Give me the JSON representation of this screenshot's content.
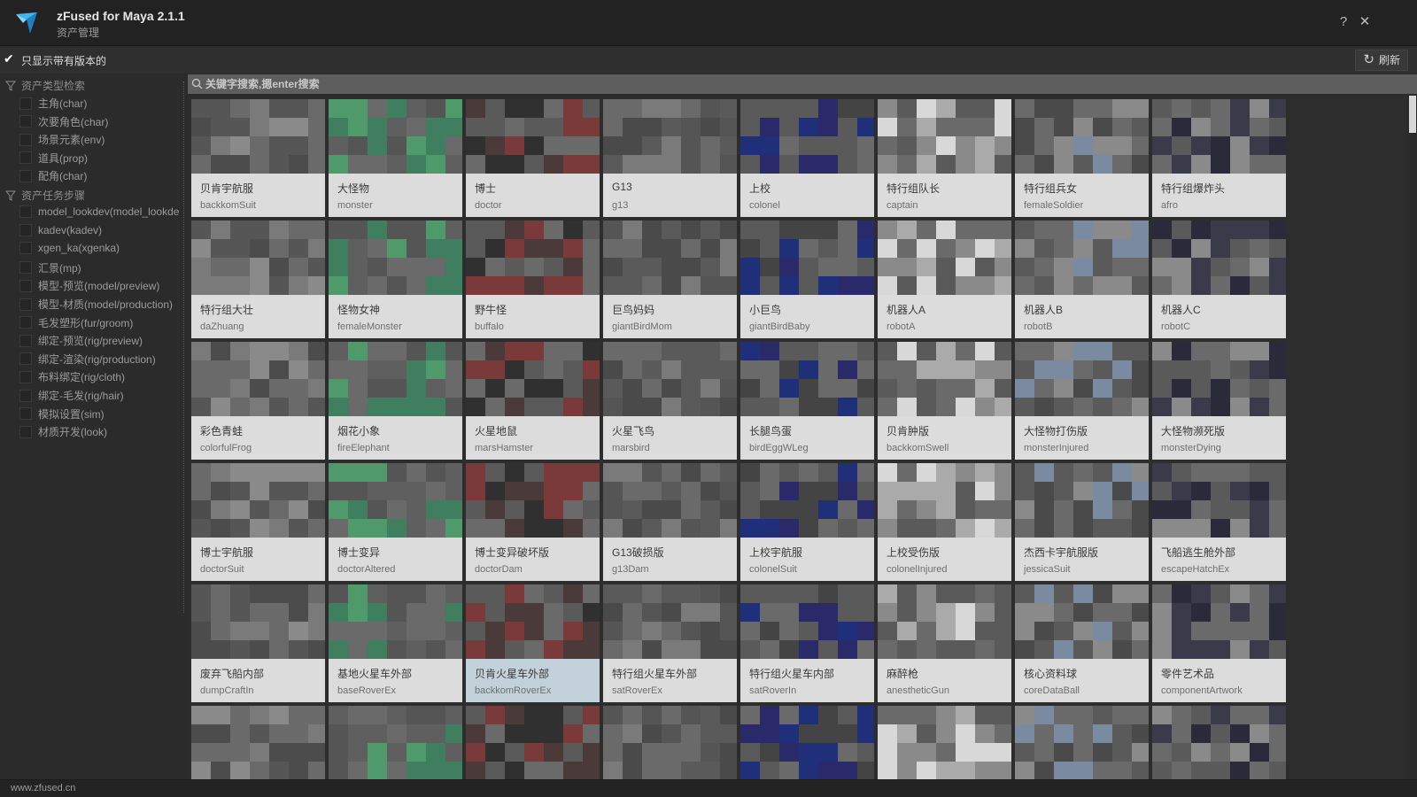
{
  "window": {
    "title": "zFused for Maya 2.1.1",
    "subtitle": "资产管理",
    "help_icon": "help-icon",
    "close_icon": "close-icon"
  },
  "options": {
    "show_versioned_label": "只显示带有版本的",
    "show_versioned_checked": true,
    "refresh_label": "刷新"
  },
  "search": {
    "placeholder": "关键字搜索,摁enter搜索",
    "value": ""
  },
  "sidebar": {
    "type_header": "资产类型检索",
    "types": [
      {
        "label": "主角(char)",
        "checked": false
      },
      {
        "label": "次要角色(char)",
        "checked": false
      },
      {
        "label": "场景元素(env)",
        "checked": false
      },
      {
        "label": "道具(prop)",
        "checked": false
      },
      {
        "label": "配角(char)",
        "checked": false
      }
    ],
    "task_header": "资产任务步骤",
    "tasks": [
      {
        "label": "model_lookdev(model_lookdev)",
        "checked": false
      },
      {
        "label": "kadev(kadev)",
        "checked": false
      },
      {
        "label": "xgen_ka(xgenka)",
        "checked": false
      },
      {
        "label": "汇景(mp)",
        "checked": false
      },
      {
        "label": "模型-预览(model/preview)",
        "checked": false
      },
      {
        "label": "模型-材质(model/production)",
        "checked": false
      },
      {
        "label": "毛发塑形(fur/groom)",
        "checked": false
      },
      {
        "label": "绑定-预览(rig/preview)",
        "checked": false
      },
      {
        "label": "绑定-渲染(rig/production)",
        "checked": false
      },
      {
        "label": "布料绑定(rig/cloth)",
        "checked": false
      },
      {
        "label": "绑定-毛发(rig/hair)",
        "checked": false
      },
      {
        "label": "模拟设置(sim)",
        "checked": false
      },
      {
        "label": "材质开发(look)",
        "checked": false
      }
    ]
  },
  "assets": [
    {
      "name": "贝肯宇航服",
      "code": "backkomSuit"
    },
    {
      "name": "大怪物",
      "code": "monster"
    },
    {
      "name": "博士",
      "code": "doctor"
    },
    {
      "name": "G13",
      "code": "g13"
    },
    {
      "name": "上校",
      "code": "colonel"
    },
    {
      "name": "特行组队长",
      "code": "captain"
    },
    {
      "name": "特行组兵女",
      "code": "femaleSoldier"
    },
    {
      "name": "特行组爆炸头",
      "code": "afro"
    },
    {
      "name": "特行组大壮",
      "code": "daZhuang"
    },
    {
      "name": "怪物女神",
      "code": "femaleMonster"
    },
    {
      "name": "野牛怪",
      "code": "buffalo"
    },
    {
      "name": "巨鸟妈妈",
      "code": "giantBirdMom"
    },
    {
      "name": "小巨鸟",
      "code": "giantBirdBaby"
    },
    {
      "name": "机器人A",
      "code": "robotA"
    },
    {
      "name": "机器人B",
      "code": "robotB"
    },
    {
      "name": "机器人C",
      "code": "robotC"
    },
    {
      "name": "彩色青蛙",
      "code": "colorfulFrog"
    },
    {
      "name": "烟花小象",
      "code": "fireElephant"
    },
    {
      "name": "火星地鼠",
      "code": "marsHamster"
    },
    {
      "name": "火星飞鸟",
      "code": "marsbird"
    },
    {
      "name": "长腿鸟蛋",
      "code": "birdEggWLeg"
    },
    {
      "name": "贝肯肿版",
      "code": "backkomSwell"
    },
    {
      "name": "大怪物打伤版",
      "code": "monsterInjured"
    },
    {
      "name": "大怪物濒死版",
      "code": "monsterDying"
    },
    {
      "name": "博士宇航服",
      "code": "doctorSuit"
    },
    {
      "name": "博士变异",
      "code": "doctorAltered"
    },
    {
      "name": "博士变异破坏版",
      "code": "doctorDam"
    },
    {
      "name": "G13破损版",
      "code": "g13Dam"
    },
    {
      "name": "上校宇航服",
      "code": "colonelSuit"
    },
    {
      "name": "上校受伤版",
      "code": "colonelInjured"
    },
    {
      "name": "杰西卡宇航服版",
      "code": "jessicaSuit"
    },
    {
      "name": "飞船逃生舱外部",
      "code": "escapeHatchEx"
    },
    {
      "name": "废弃飞船内部",
      "code": "dumpCraftIn"
    },
    {
      "name": "基地火星车外部",
      "code": "baseRoverEx"
    },
    {
      "name": "贝肯火星车外部",
      "code": "backkomRoverEx",
      "selected": true
    },
    {
      "name": "特行组火星车外部",
      "code": "satRoverEx"
    },
    {
      "name": "特行组火星车内部",
      "code": "satRoverIn"
    },
    {
      "name": "麻醉枪",
      "code": "anestheticGun"
    },
    {
      "name": "核心资料球",
      "code": "coreDataBall"
    },
    {
      "name": "零件艺术品",
      "code": "componentArtwork"
    },
    {
      "name": "",
      "code": ""
    },
    {
      "name": "",
      "code": ""
    },
    {
      "name": "",
      "code": ""
    },
    {
      "name": "",
      "code": ""
    },
    {
      "name": "",
      "code": ""
    },
    {
      "name": "",
      "code": ""
    },
    {
      "name": "",
      "code": ""
    },
    {
      "name": "",
      "code": ""
    }
  ],
  "status": {
    "text": "www.zfused.cn"
  },
  "colors": {
    "accent": "#2aa4e6",
    "selected": "#c3d1db",
    "card": "#dcdcdc"
  }
}
